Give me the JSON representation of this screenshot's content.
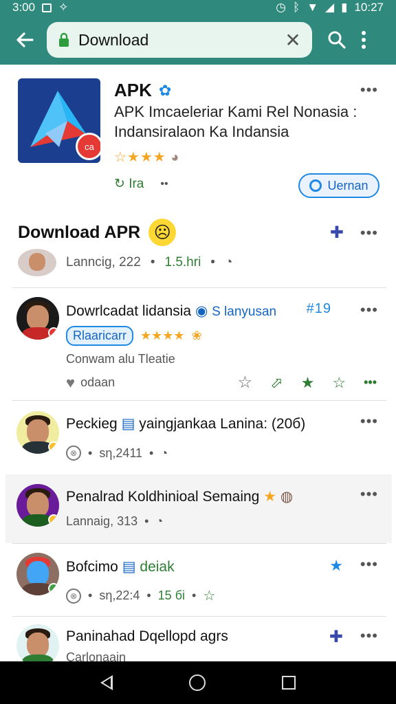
{
  "status_bar": {
    "left_text": "3:00",
    "time": "10:27"
  },
  "app_bar": {
    "search_value": "Download"
  },
  "app": {
    "title": "APK",
    "subtitle1": "APK Imcaeleriar Kami Rel Nonasia :",
    "subtitle2": "Indansiralaon Ka Indansia",
    "rating_text": "☆★★★",
    "install_label": "Ira",
    "update_label": "Uernan",
    "badge_text": "ca"
  },
  "section": {
    "title": "Download APR",
    "meta_lang": "Lanncig, 222",
    "meta_size": "1.5.hri"
  },
  "items": [
    {
      "title": "Dowrlcadat lidansia",
      "tag": "S lanyusan",
      "count": "#19",
      "pill": "Rlaaricarr",
      "subtitle": "Conwam alu Tleatie",
      "like_label": "odaan"
    },
    {
      "title": "Peckieg",
      "title_tail": "yaingjankaa Lanina: (20б)",
      "meta": "sη,2411"
    },
    {
      "title": "Penalrad Koldhinioal Semaing",
      "meta": "Lannaig, 313"
    },
    {
      "title": "Bofcimo",
      "tag": "deiak",
      "meta1": "sη,22:4",
      "meta2": "15 бi"
    },
    {
      "title": "Paninahad Dqellopd agrs",
      "subtitle": "Carlonaain"
    }
  ],
  "colors": {
    "app_bar": "#2f8a7d",
    "search_pill": "#e8f5ef",
    "accent_blue": "#1e88e5",
    "star": "#f4a623",
    "green": "#2e7d32"
  }
}
